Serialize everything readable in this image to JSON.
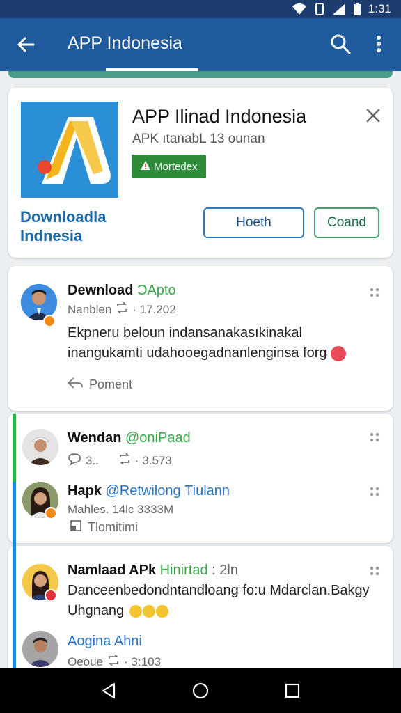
{
  "status_bar": {
    "time": "1:31"
  },
  "app_bar": {
    "title": "APP Indonesia"
  },
  "app_card": {
    "name": "APP Ilinad Indonesia",
    "subtitle": "APK ıtanabL 13 ounan",
    "badge": "Mortedex",
    "download_label": "Downloadla Indnesia",
    "button_primary": "Hoeth",
    "button_secondary": "Coand"
  },
  "posts": [
    {
      "name": "Dewnload",
      "handle": "ƆApto",
      "meta_left": "Nanblen",
      "meta_right": "· 17.202",
      "body": "Ekpneru beloun indansanakasıkinakal inangukamti udahooegadnanlenginsa forg",
      "action": "Poment"
    },
    {
      "name": "Wendan",
      "handle": "@oniPaad",
      "meta_left": "3..",
      "meta_right": "· 3.573"
    },
    {
      "name": "Hapk",
      "handle": "@Retwilong",
      "handle2": "Tiulann",
      "meta_left": "Mahles. 14lc 3333M",
      "action": "Tlomitimi"
    },
    {
      "name": "Namlaad APk",
      "handle": "Hinirtad",
      "time": ": 2ln",
      "body": "Danceenbedondntandloang fo:u Mdarclan.Bakgy Uhgnang"
    },
    {
      "name": "Aogina Ahni",
      "meta_left": "Oeoue",
      "meta_right": "· 3:103"
    }
  ],
  "colors": {
    "status_bar": "#1d3c6e",
    "app_bar": "#1e5a9c",
    "accent_green": "#2e8b3a",
    "accent_blue": "#2a88d0",
    "handle_green": "#3aa84a",
    "handle_blue": "#2b76c9"
  }
}
